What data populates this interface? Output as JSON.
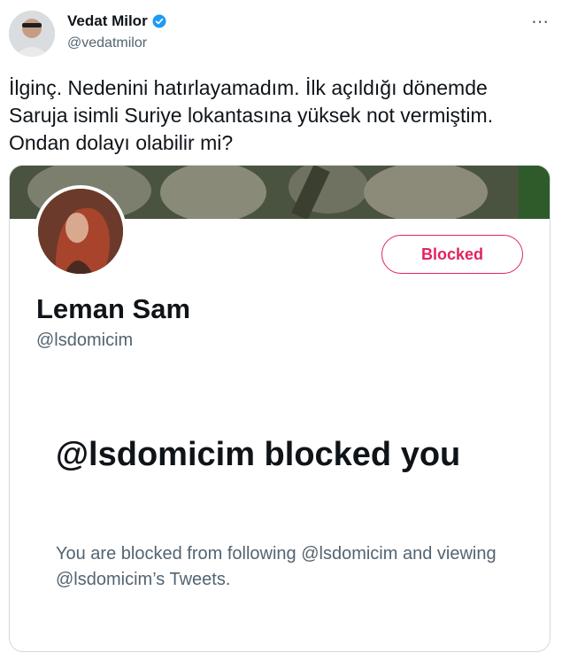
{
  "author": {
    "name": "Vedat Milor",
    "handle": "@vedatmilor"
  },
  "tweet": {
    "text": "İlginç. Nedenini hatırlayamadım. İlk açıldığı dönemde Saruja isimli Suriye lokantasına yüksek not vermiştim. Ondan dolayı olabilir mi?"
  },
  "embedded_profile": {
    "name": "Leman Sam",
    "handle": "@lsdomicim",
    "blocked_button_label": "Blocked",
    "blocked_title": "@lsdomicim blocked you",
    "blocked_message": "You are blocked from following @lsdomicim and viewing @lsdomicim’s Tweets."
  },
  "colors": {
    "blocked_red": "#e0245e",
    "verified_blue": "#1d9bf0",
    "secondary_text": "#536471"
  },
  "icons": {
    "verified": "verified-badge-icon",
    "more": "more-options-icon"
  }
}
